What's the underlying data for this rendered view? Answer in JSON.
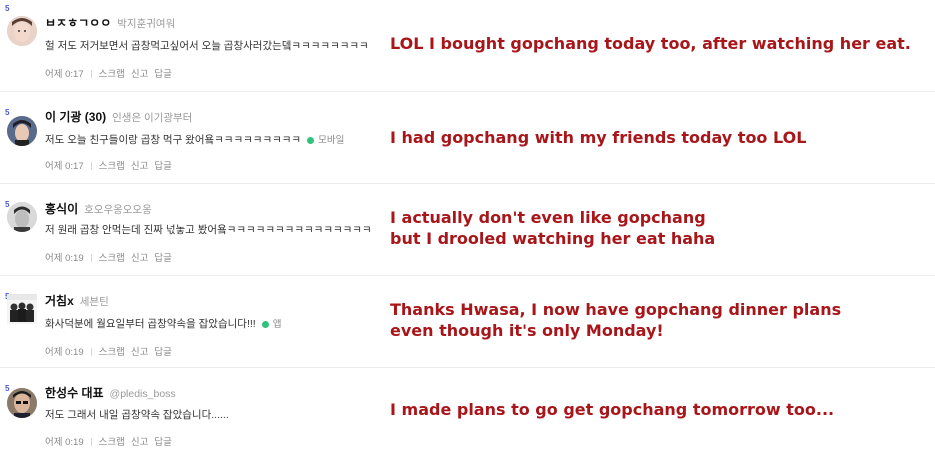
{
  "colors": {
    "translation": "#a8161a",
    "status_dot": "#2ec27e",
    "level_badge": "#4a5bd0"
  },
  "comments": [
    {
      "level": "5",
      "nickname": "ㅂㅈㅎㄱㅇㅇ",
      "blog": "박지훈귀여워",
      "text": "헐 저도 저거보면서 곱창먹고싶어서 오늘 곱창사러갔는뎈ㅋㅋㅋㅋㅋㅋㅋㅋ",
      "device": "",
      "time": "어제 0:17",
      "actions": [
        "스크랩",
        "신고",
        "답글"
      ],
      "translation": [
        "LOL I bought gopchang today too, after watching her eat."
      ]
    },
    {
      "level": "5",
      "nickname": "이 기광 (30)",
      "blog": "인생은 이기광부터",
      "text": "저도 오늘 친구들이랑 곱창 먹구 왔어욬ㅋㅋㅋㅋㅋㅋㅋㅋㅋ",
      "device": "모바일",
      "time": "어제 0:17",
      "actions": [
        "스크랩",
        "신고",
        "답글"
      ],
      "translation": [
        "I had gopchang with my friends today too LOL"
      ]
    },
    {
      "level": "5",
      "nickname": "홍식이",
      "blog": "호오우옹오오옹",
      "text": "저 원래 곱창 안먹는데 진짜 넋놓고 봤어욬ㅋㅋㅋㅋㅋㅋㅋㅋㅋㅋㅋㅋㅋㅋㅋ",
      "device": "",
      "time": "어제 0:19",
      "actions": [
        "스크랩",
        "신고",
        "답글"
      ],
      "translation": [
        "I actually don't even like gopchang",
        "but I drooled watching her eat haha"
      ]
    },
    {
      "level": "5",
      "nickname": "거침x",
      "blog": "세븐틴",
      "text": "화사덕분에 월요일부터 곱창약속을 잡았습니다!!!",
      "device": "앱",
      "time": "어제 0:19",
      "actions": [
        "스크랩",
        "신고",
        "답글"
      ],
      "translation": [
        "Thanks Hwasa, I now have gopchang dinner plans",
        "even though it's only Monday!"
      ]
    },
    {
      "level": "5",
      "nickname": "한성수 대표",
      "blog": "@pledis_boss",
      "text": "저도 그래서 내일 곱창약속 잡았습니다......",
      "device": "",
      "time": "어제 0:19",
      "actions": [
        "스크랩",
        "신고",
        "답글"
      ],
      "translation": [
        "I made plans to go get gopchang tomorrow too..."
      ]
    }
  ]
}
